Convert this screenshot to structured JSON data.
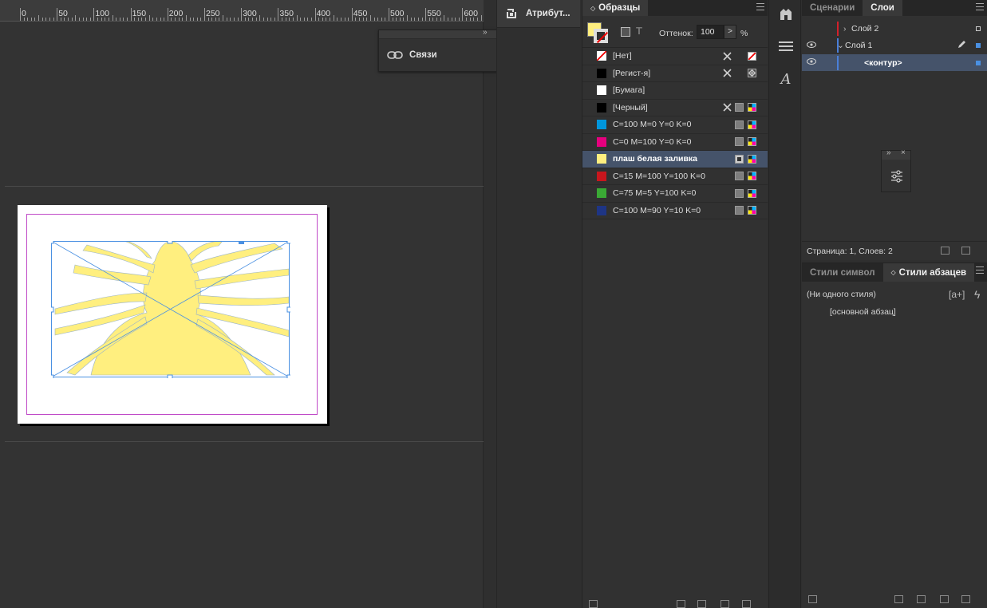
{
  "ruler": {
    "labels": [
      "0",
      "50",
      "100",
      "150",
      "200",
      "250",
      "300",
      "350",
      "400",
      "450",
      "500",
      "550",
      "600"
    ]
  },
  "links_panel": {
    "collapse_glyph": "»",
    "close_glyph": "×",
    "title": "Связи",
    "icon": "chain-link-icon"
  },
  "attributes_tab": {
    "title": "Атрибут...",
    "icon": "attributes-icon"
  },
  "swatches": {
    "tab_label": "Образцы",
    "tab_arrow": "◇",
    "tint_label": "Оттенок:",
    "tint_value": "100",
    "tint_button": ">",
    "tint_unit": "%",
    "text_icon": "T",
    "items": [
      {
        "name": "[Нет]",
        "color": "none",
        "edit_lock": true,
        "mode": "none"
      },
      {
        "name": "[Регист-я]",
        "color": "#000000",
        "edit_lock": true,
        "mode": "registration"
      },
      {
        "name": "[Бумага]",
        "color": "#ffffff",
        "edit_lock": false,
        "mode": ""
      },
      {
        "name": "[Черный]",
        "color": "#000000",
        "edit_lock": true,
        "mode": "cmyk"
      },
      {
        "name": "C=100 M=0 Y=0 K=0",
        "color": "#0096dc",
        "edit_lock": false,
        "mode": "cmyk"
      },
      {
        "name": "C=0 M=100 Y=0 K=0",
        "color": "#e6007e",
        "edit_lock": false,
        "mode": "cmyk"
      },
      {
        "name": "плаш белая заливка",
        "color": "#ffef7f",
        "edit_lock": false,
        "mode": "spot",
        "selected": true
      },
      {
        "name": "C=15 M=100 Y=100 K=0",
        "color": "#c8161d",
        "edit_lock": false,
        "mode": "cmyk"
      },
      {
        "name": "C=75 M=5 Y=100 K=0",
        "color": "#3aa935",
        "edit_lock": false,
        "mode": "cmyk"
      },
      {
        "name": "C=100 M=90 Y=10 K=0",
        "color": "#1e3585",
        "edit_lock": false,
        "mode": "cmyk"
      }
    ]
  },
  "layers": {
    "tabs": [
      "Сценарии",
      "Слои"
    ],
    "active_tab": "Слои",
    "rows": [
      {
        "name": "Слой 2",
        "arrow": "›",
        "color": "#d4202a",
        "visible": false
      },
      {
        "name": "Слой 1",
        "arrow": "⌄",
        "color": "#4a7fd8",
        "visible": true
      },
      {
        "name": "<контур>",
        "arrow": "",
        "color": "#4a7fd8",
        "visible": true,
        "selected": true
      }
    ],
    "status": "Страница: 1, Слоев: 2"
  },
  "mini_panel": {
    "collapse_glyph": "»",
    "close_glyph": "×",
    "icon": "sliders-icon"
  },
  "styles": {
    "tabs": [
      "Стили символ",
      "Стили абзацев"
    ],
    "active_tab": "Стили абзацев",
    "tab_arrow": "◇",
    "none_style": "(Ни одного стиля)",
    "new_style_glyph": "[a+]",
    "lightning_glyph": "ϟ",
    "items": [
      "[основной абзац]"
    ]
  },
  "colors": {
    "accent_selected": "#45536a",
    "page_margin": "#c04bc8",
    "art_fill": "#ffef7f",
    "frame": "#4a90e2"
  }
}
